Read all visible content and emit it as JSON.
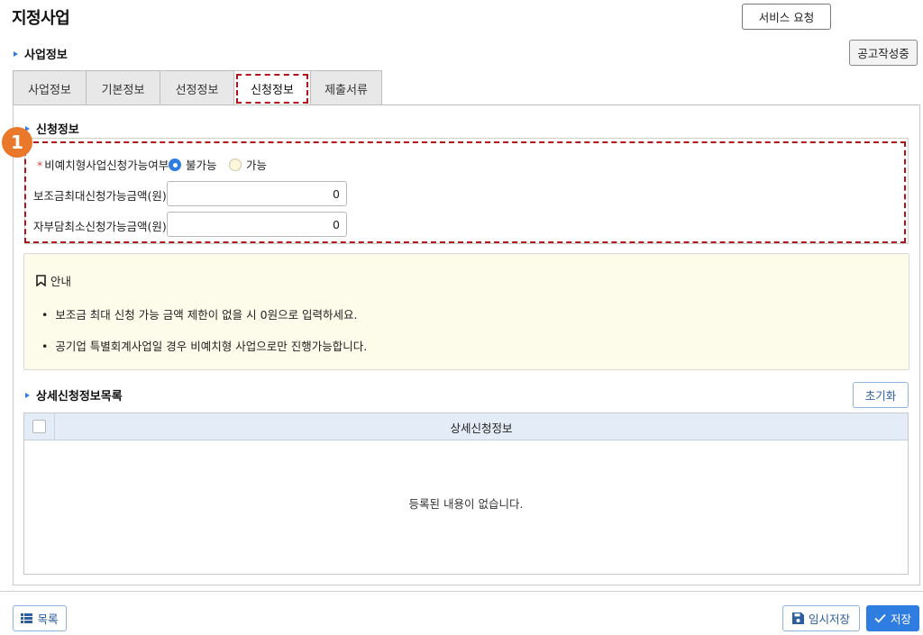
{
  "page": {
    "title": "지정사업"
  },
  "header": {
    "service_request_label": "서비스 요청"
  },
  "section_business": {
    "title": "사업정보"
  },
  "notice_button_label": "공고작성중",
  "tabs": [
    {
      "label": "사업정보"
    },
    {
      "label": "기본정보"
    },
    {
      "label": "선정정보"
    },
    {
      "label": "신청정보"
    },
    {
      "label": "제출서류"
    }
  ],
  "badge_number": "1",
  "application_section": {
    "title": "신청정보",
    "non_expense_label": "비예치형사업신청가능여부",
    "required_mark": "*",
    "options": [
      {
        "label": "불가능",
        "selected": true
      },
      {
        "label": "가능",
        "selected": false
      }
    ],
    "max_subsidy_label": "보조금최대신청가능금액(원)",
    "max_subsidy_value": "0",
    "min_selfpay_label": "자부담최소신청가능금액(원)",
    "min_selfpay_value": "0"
  },
  "info_box": {
    "title": "안내",
    "bullets": [
      "보조금 최대 신청 가능 금액 제한이 없을 시 0원으로 입력하세요.",
      "공기업 특별회계사업일 경우 비예치형 사업으로만 진행가능합니다."
    ]
  },
  "detail_section": {
    "title": "상세신청정보목록",
    "reset_label": "초기화",
    "column_header": "상세신청정보",
    "empty_message": "등록된 내용이 없습니다."
  },
  "footer": {
    "list_label": "목록",
    "temp_save_label": "임시저장",
    "save_label": "저장"
  },
  "icons": {
    "list": "list-icon",
    "save_disk": "floppy-disk-icon",
    "check": "check-icon",
    "bookmark": "bookmark-icon"
  },
  "colors": {
    "accent": "#2f7de1",
    "highlight": "#b1121a",
    "badge": "#e9782b",
    "info_bg": "#fdfbe9"
  }
}
